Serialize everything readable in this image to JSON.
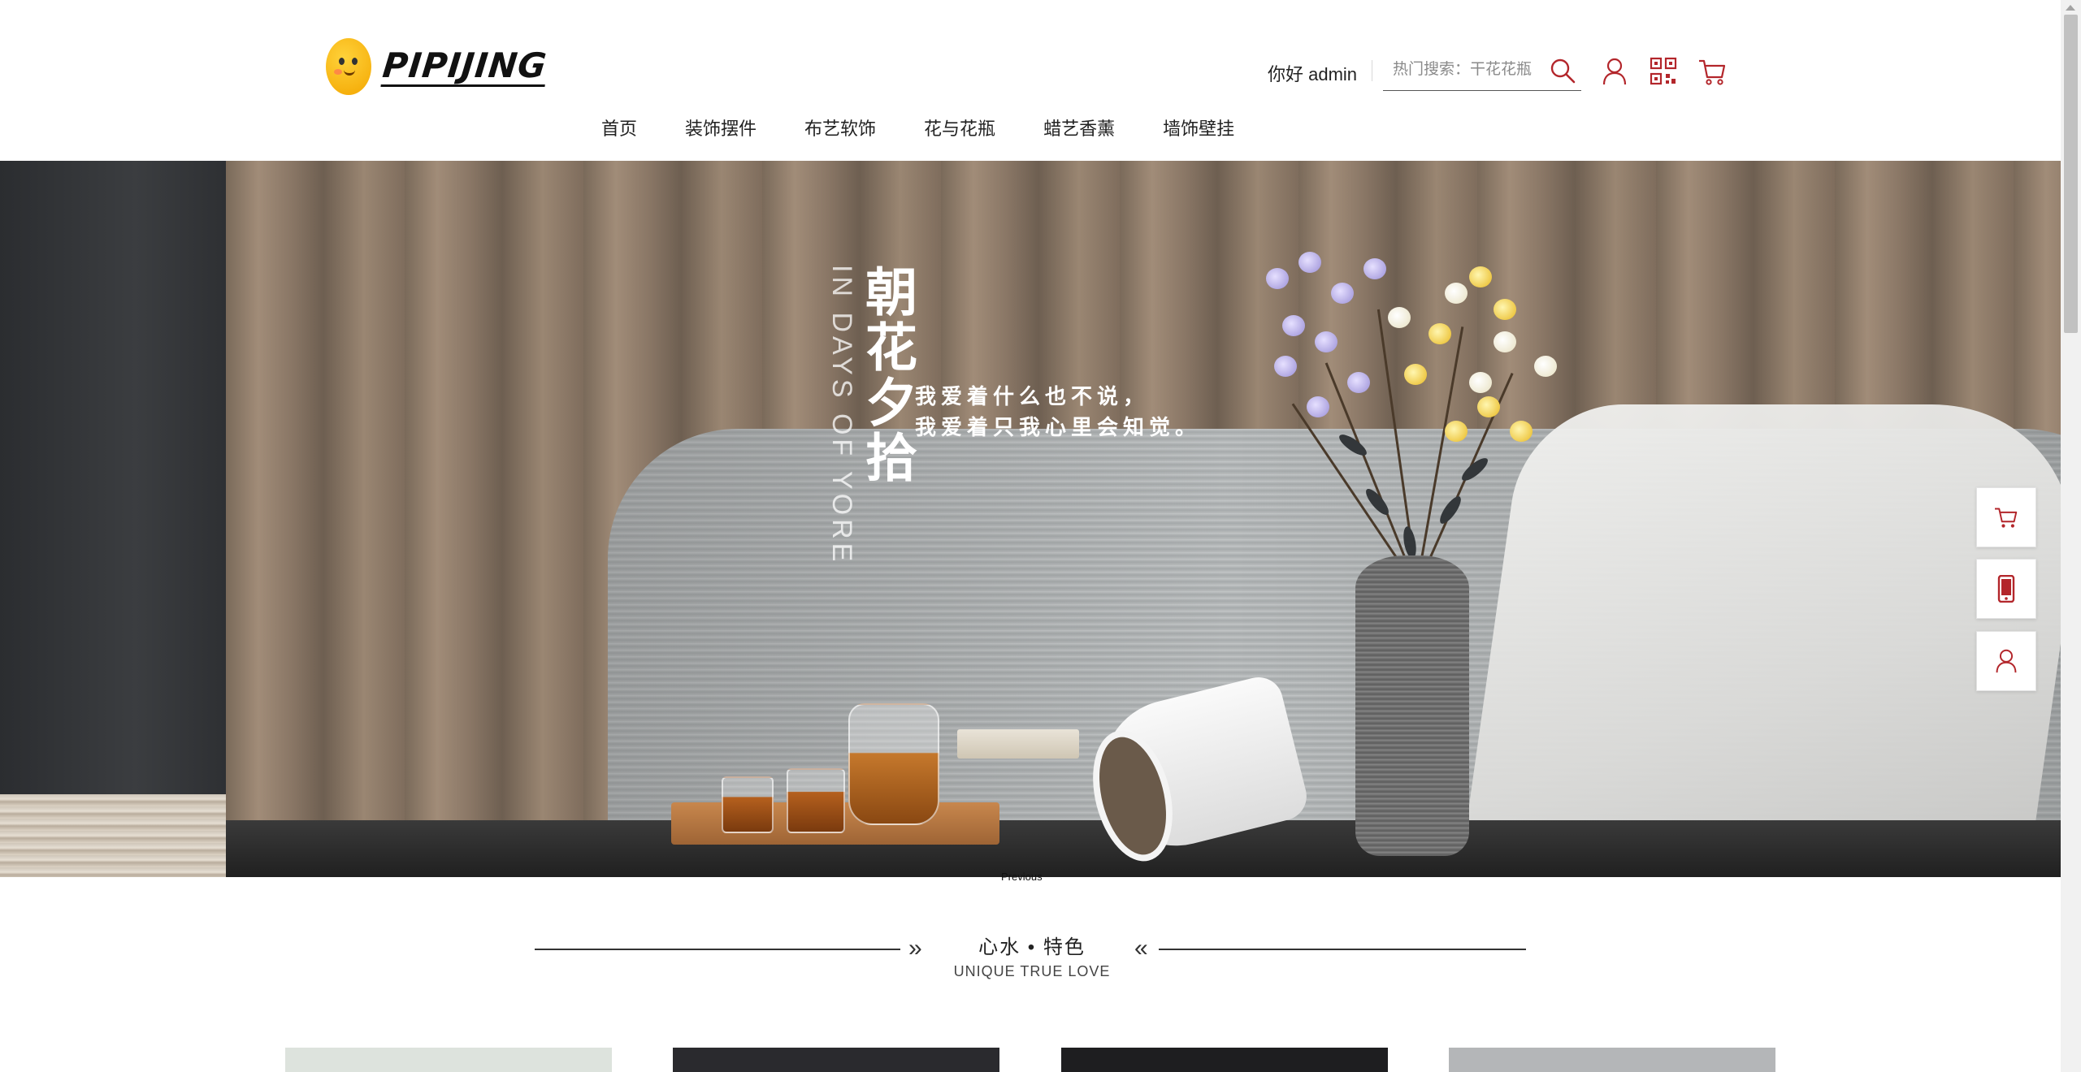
{
  "header": {
    "logo_text": "PIPIJING",
    "greeting": "你好 admin",
    "search": {
      "placeholder": "热门搜索：干花花瓶"
    },
    "icons": [
      "search-icon",
      "user-icon",
      "qrcode-icon",
      "cart-icon"
    ],
    "accent_color": "#b3262b"
  },
  "nav": {
    "items": [
      {
        "label": "首页"
      },
      {
        "label": "装饰摆件"
      },
      {
        "label": "布艺软饰"
      },
      {
        "label": "花与花瓶"
      },
      {
        "label": "蜡艺香薰"
      },
      {
        "label": "墙饰壁挂"
      }
    ]
  },
  "banner": {
    "vertical_en": "IN DAYS OF YORE",
    "title": "朝花夕拾",
    "line1": "我爱着什么也不说，",
    "line2": "我爱着只我心里会知觉。",
    "caption": "Previous"
  },
  "side_float": {
    "icons": [
      "cart-icon",
      "phone-icon",
      "user-icon"
    ]
  },
  "section": {
    "title": "心水 • 特色",
    "subtitle": "UNIQUE TRUE LOVE",
    "left_arrow": "»",
    "right_arrow": "«"
  },
  "products": {
    "card_colors": [
      "#dde3dd",
      "#2a2a2e",
      "#1e1e20",
      "#b4b6b8"
    ]
  }
}
